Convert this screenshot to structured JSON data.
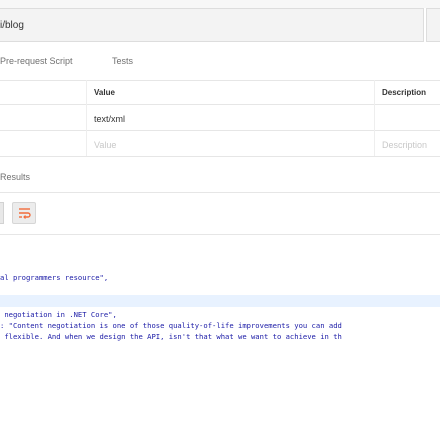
{
  "request": {
    "url_fragment": "i/blog"
  },
  "tabs": [
    {
      "label": "Pre-request Script"
    },
    {
      "label": "Tests"
    }
  ],
  "params_table": {
    "col_value": "Value",
    "col_description": "Description",
    "row_value": "text/xml",
    "placeholder_value": "Value",
    "placeholder_description": "Description"
  },
  "response": {
    "results_label": "Results",
    "lines": [
      "al programmers resource\",",
      " negotiation in .NET Core\",",
      ": \"Content negotiation is one of those quality-of-life improvements you can add",
      " flexible. And when we design the API, isn't that what we want to achieve in th"
    ]
  },
  "icons": {
    "wrap": "wrap-lines-icon"
  },
  "colors": {
    "accent": "#f26b3a",
    "code_text": "#1a1aa6",
    "line_highlight": "#e8f2ff"
  }
}
